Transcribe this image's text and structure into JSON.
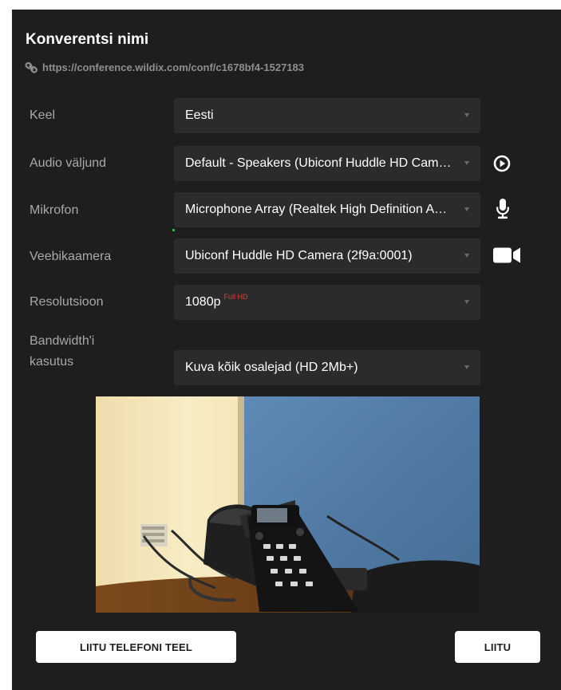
{
  "conference": {
    "title": "Konverentsi nimi",
    "url": "https://conference.wildix.com/conf/c1678bf4-1527183"
  },
  "settings": [
    {
      "label": "Keel",
      "value": "Eesti"
    },
    {
      "label": "Audio väljund",
      "value": "Default - Speakers (Ubiconf Huddle HD Camera)",
      "icon": "play-circle-icon"
    },
    {
      "label": "Mikrofon",
      "value": "Microphone Array (Realtek High Definition Audio)",
      "icon": "microphone-icon"
    },
    {
      "label": "Veebikaamera",
      "value": "Ubiconf Huddle HD Camera (2f9a:0001)",
      "icon": "video-camera-icon"
    },
    {
      "label": "Resolutsioon",
      "value": "1080p",
      "badge": "Full HD"
    },
    {
      "label": "Bandwidth'i kasutus",
      "value": "Kuva kõik osalejad (HD 2Mb+)"
    }
  ],
  "buttons": {
    "join_by_phone": "LIITU TELEFONI TEEL",
    "join": "LIITU"
  },
  "colors": {
    "panel_bg": "#1e1e1e",
    "select_bg": "#2b2b2b",
    "label": "#a9a9a9",
    "badge": "#e53935"
  }
}
